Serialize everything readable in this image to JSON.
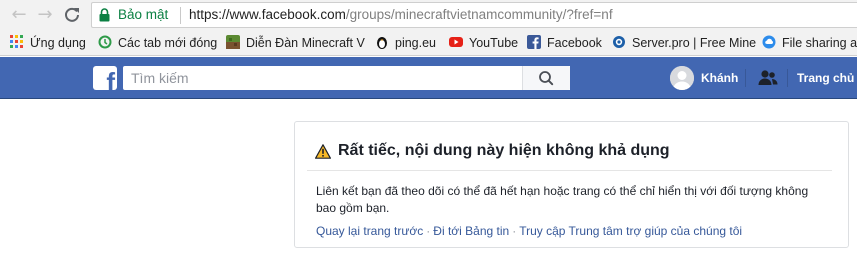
{
  "browser": {
    "secure_label": "Bảo mật",
    "url_host": "https://www.facebook.com",
    "url_path": "/groups/minecraftvietnamcommunity/?fref=nf"
  },
  "bookmarks": [
    {
      "label": "Ứng dụng",
      "icon": "apps-grid-icon"
    },
    {
      "label": "Các tab mới đóng",
      "icon": "history-icon"
    },
    {
      "label": "Diễn Đàn Minecraft V",
      "icon": "minecraft-icon"
    },
    {
      "label": "ping.eu",
      "icon": "penguin-icon"
    },
    {
      "label": "YouTube",
      "icon": "youtube-icon"
    },
    {
      "label": "Facebook",
      "icon": "facebook-icon"
    },
    {
      "label": "Server.pro | Free Mine",
      "icon": "serverpro-icon"
    },
    {
      "label": "File sharing an",
      "icon": "cloud-icon"
    }
  ],
  "fb": {
    "search_placeholder": "Tìm kiếm",
    "user_name": "Khánh",
    "home_label": "Trang chủ"
  },
  "content": {
    "title": "Rất tiếc, nội dung này hiện không khả dụng",
    "body": "Liên kết bạn đã theo dõi có thể đã hết hạn hoặc trang có thể chỉ hiển thị với đối tượng không bao gồm bạn.",
    "links": [
      "Quay lại trang trước",
      "Đi tới Bảng tin",
      "Truy cập Trung tâm trợ giúp của chúng tôi"
    ],
    "link_separator": "·"
  },
  "colors": {
    "fb_blue": "#4267b2",
    "link": "#365899",
    "secure_green": "#0b8043",
    "warning_yellow": "#f7b928"
  }
}
